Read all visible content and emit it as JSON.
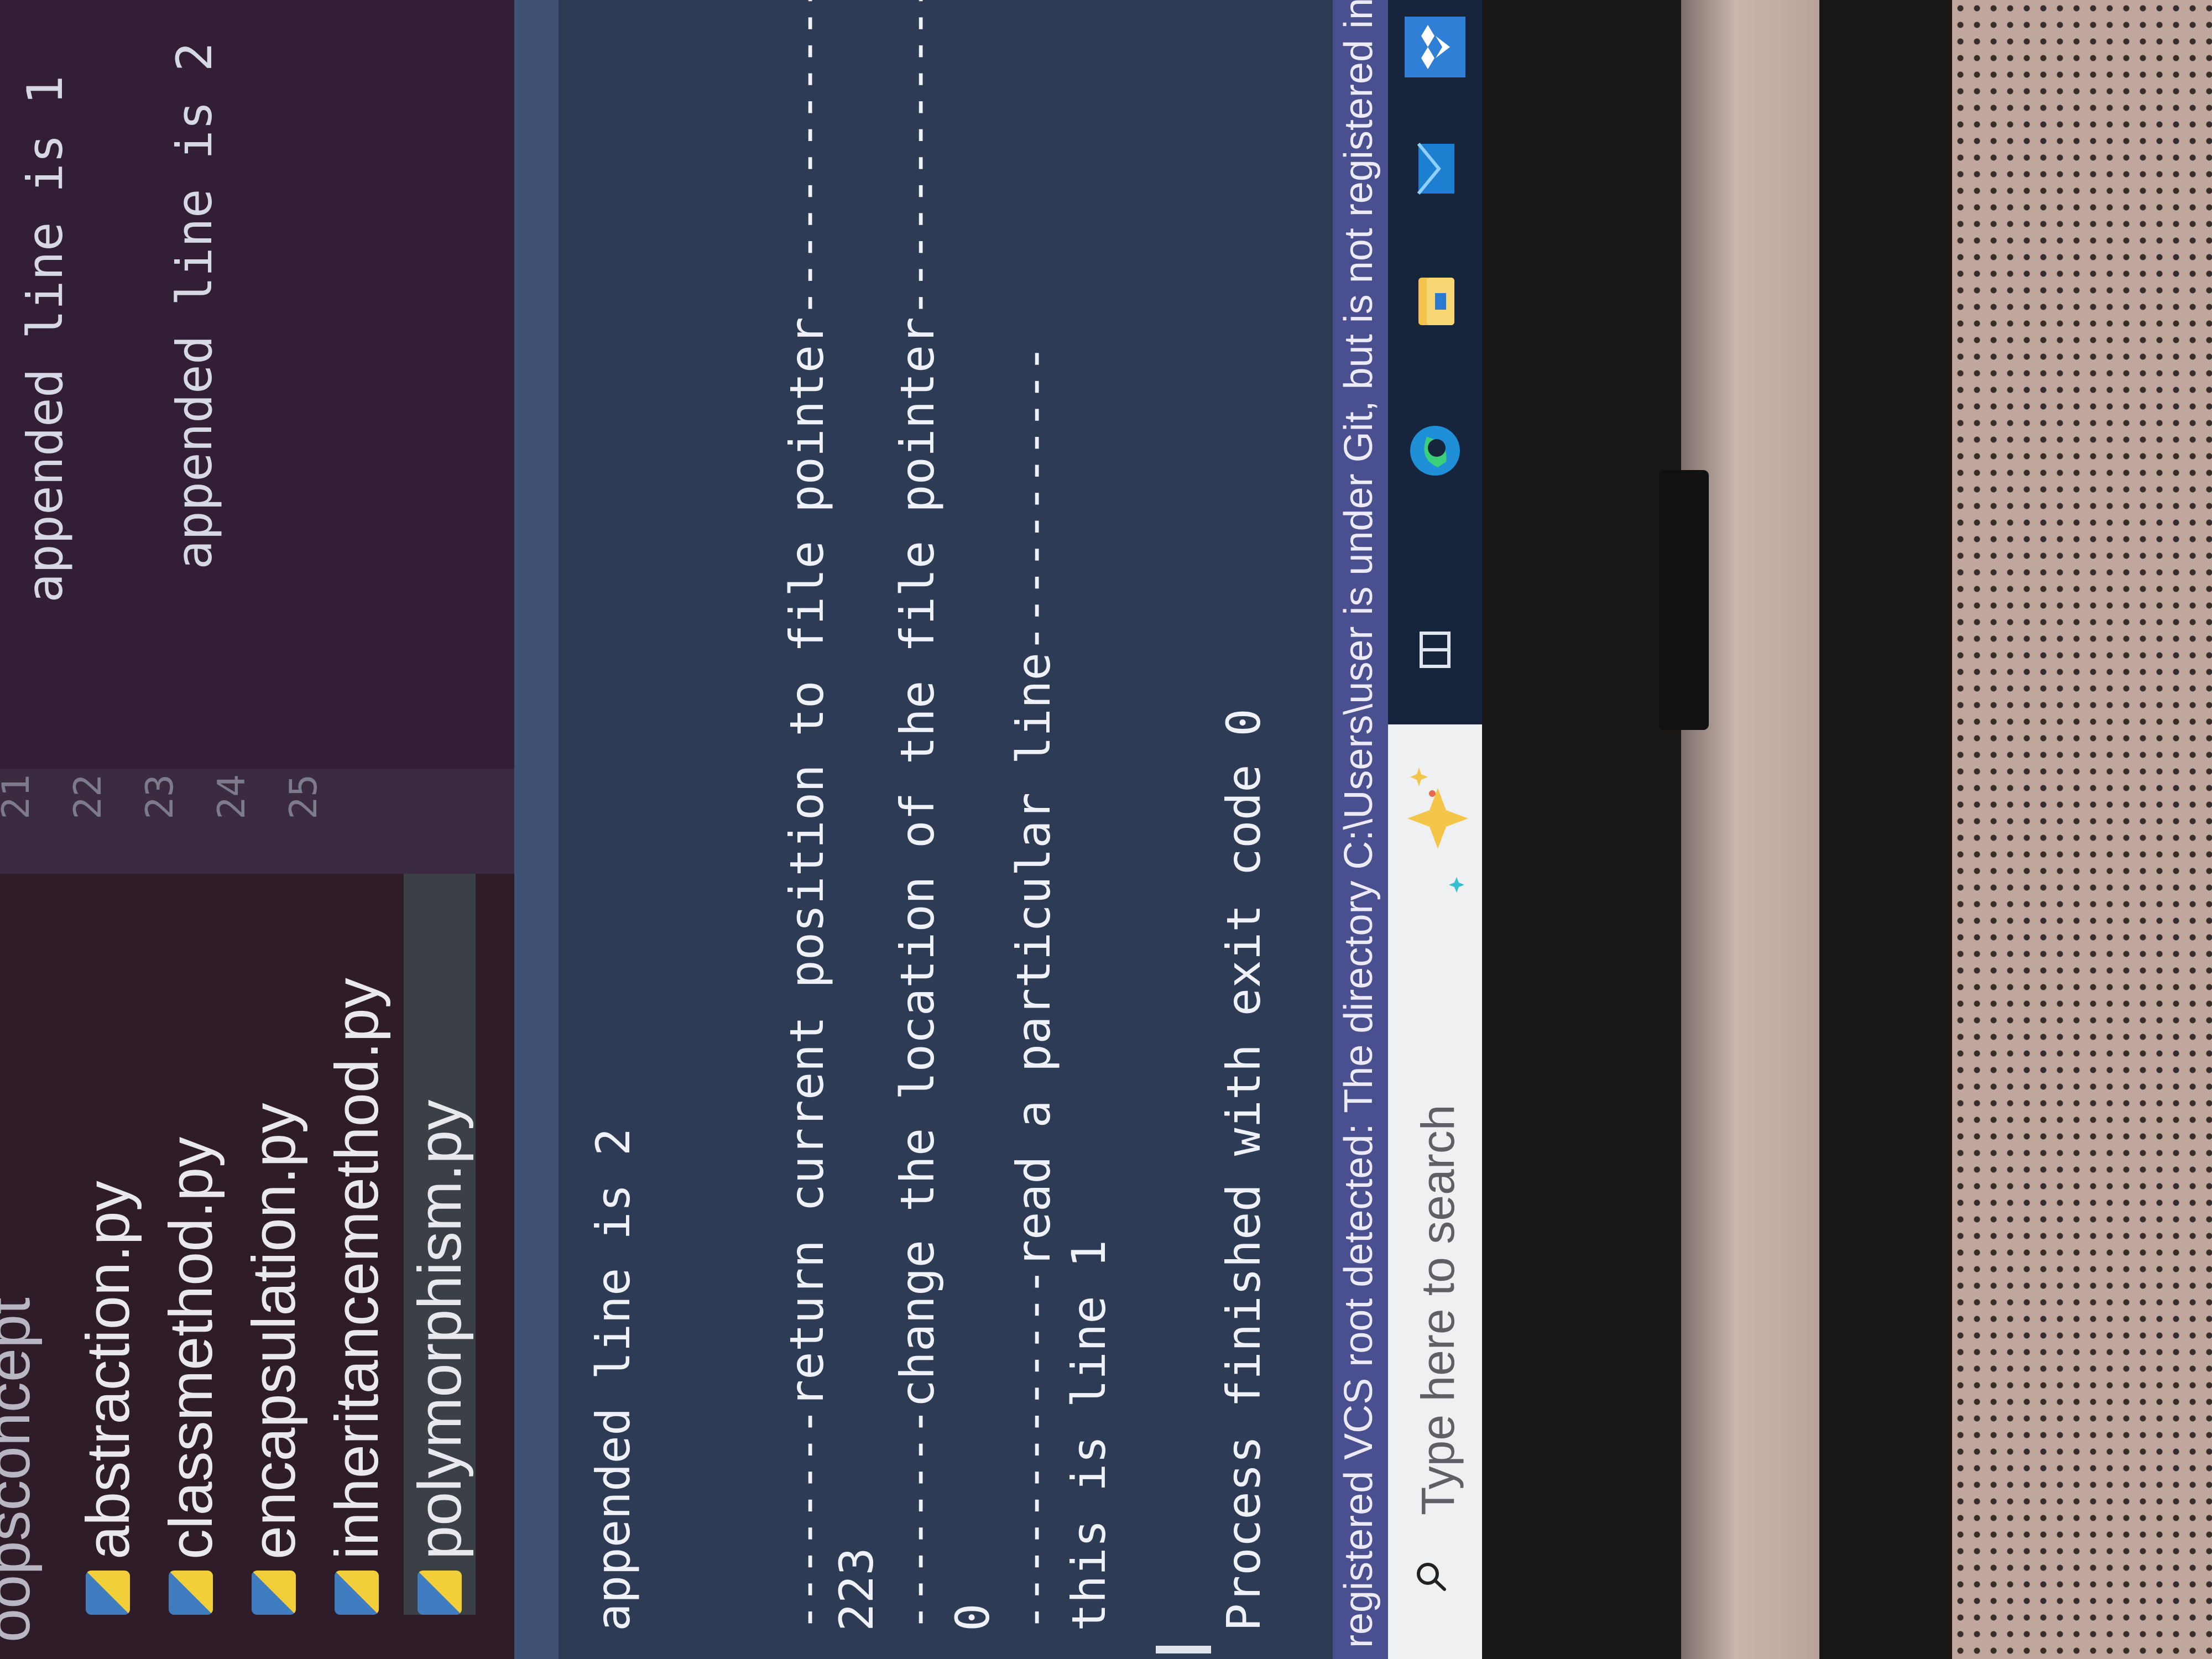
{
  "project_tree": {
    "folder": "oopsconcept",
    "files": [
      "abstraction.py",
      "classmethod.py",
      "encapsulation.py",
      "inheritancemethod.py",
      "polymorphism.py"
    ],
    "selected": "polymorphism.py"
  },
  "editor": {
    "line_numbers": [
      "21",
      "22",
      "23",
      "24",
      "25"
    ],
    "lines": [
      "appended line is 1",
      "appended line is 2"
    ]
  },
  "console": {
    "lines": [
      "appended line is 2",
      "--------return current position to file pointer---------------",
      "223",
      "--------change the location of the file pointer---------------",
      "0",
      "-------------read a particular line-----------",
      "this is line 1",
      "Process finished with exit code 0"
    ]
  },
  "status_bar": {
    "message": "registered VCS root detected: The directory C:\\Users\\user is under Git, but is not registered in the Setti"
  },
  "taskbar": {
    "search_placeholder": "Type here to search",
    "icons": [
      "task-view-icon",
      "edge-icon",
      "file-explorer-icon",
      "mail-icon",
      "dropbox-icon"
    ]
  },
  "colors": {
    "project_panel": "#2f1c29",
    "editor_bg": "#331f35",
    "run_panel": "#2e3b55",
    "status_bar": "#4a4f8f",
    "taskbar": "#17253c",
    "accent_blue": "#2f7fd6"
  }
}
